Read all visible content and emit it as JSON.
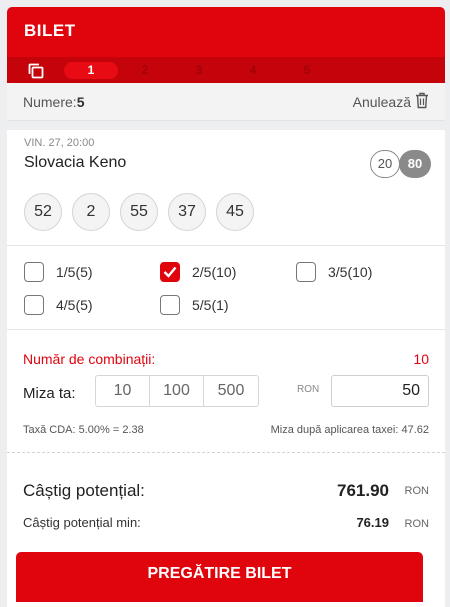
{
  "header": {
    "title": "BILET",
    "tabs": [
      "1",
      "2",
      "3",
      "4",
      "5"
    ],
    "active_tab": "1",
    "accent_color": "#e0040d"
  },
  "numbers_row": {
    "label": "Numere:",
    "count": "5",
    "cancel_label": "Anulează"
  },
  "draw": {
    "date": "VIN. 27, 20:00",
    "name": "Slovacia Keno",
    "pill_left": "20",
    "pill_right": "80",
    "balls": [
      "52",
      "2",
      "55",
      "37",
      "45"
    ]
  },
  "combinations": [
    {
      "label": "1/5(5)",
      "checked": false
    },
    {
      "label": "2/5(10)",
      "checked": true
    },
    {
      "label": "3/5(10)",
      "checked": false
    },
    {
      "label": "4/5(5)",
      "checked": false
    },
    {
      "label": "5/5(1)",
      "checked": false
    }
  ],
  "stake": {
    "combo_count_label": "Număr de combinații:",
    "combo_count": "10",
    "stake_label": "Miza ta:",
    "quick_amounts": [
      "10",
      "100",
      "500"
    ],
    "currency": "RON",
    "stake_value": "50",
    "tax_text": "Taxă CDA: 5.00% = 2.38",
    "after_tax_text": "Miza după aplicarea taxei: 47.62"
  },
  "winnings": {
    "potential_label": "Câștig potențial:",
    "potential_value": "761.90",
    "potential_min_label": "Câștig potențial min:",
    "potential_min_value": "76.19",
    "currency": "RON"
  },
  "cta": {
    "label": "PREGĂTIRE BILET"
  }
}
